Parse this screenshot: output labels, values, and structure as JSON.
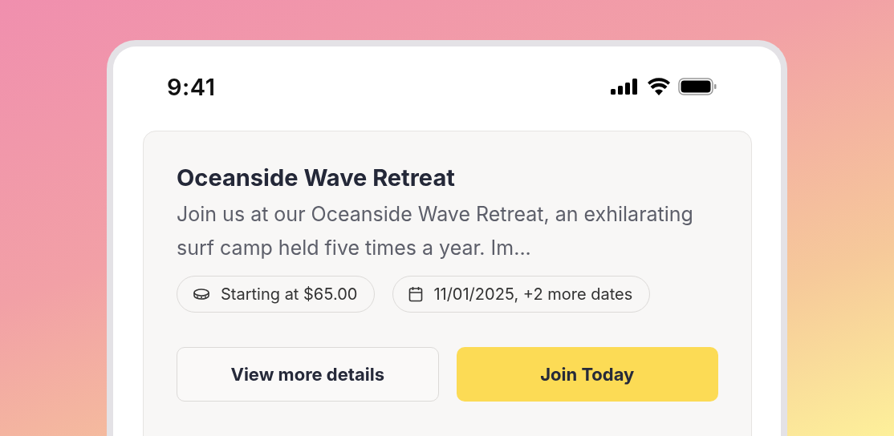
{
  "status_bar": {
    "time": "9:41"
  },
  "event": {
    "title": "Oceanside Wave Retreat",
    "description": "Join us at our Oceanside Wave Retreat, an exhilarating surf camp held five times a year. Im...",
    "chips": [
      {
        "kind": "price",
        "label": "Starting at $65.00"
      },
      {
        "kind": "date",
        "label": "11/01/2025, +2 more dates"
      }
    ],
    "buttons": [
      {
        "kind": "secondary",
        "label": "View more details"
      },
      {
        "kind": "primary",
        "label": "Join Today"
      }
    ]
  }
}
